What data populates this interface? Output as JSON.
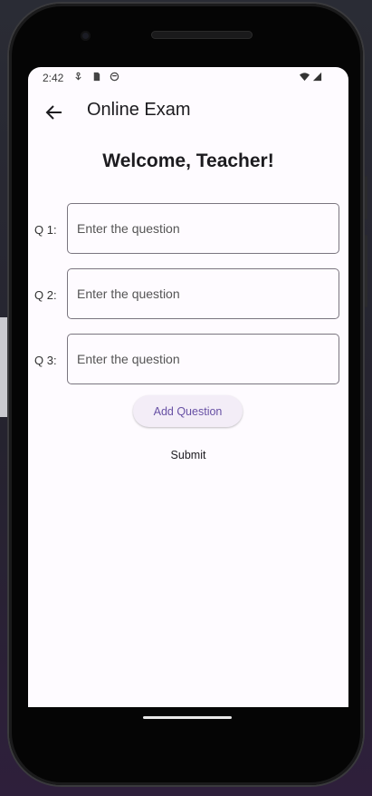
{
  "status_bar": {
    "time": "2:42"
  },
  "app_bar": {
    "title": "Online Exam"
  },
  "welcome_text": "Welcome, Teacher!",
  "questions": [
    {
      "label": "Q 1:",
      "placeholder": "Enter the question",
      "value": ""
    },
    {
      "label": "Q 2:",
      "placeholder": "Enter the question",
      "value": ""
    },
    {
      "label": "Q 3:",
      "placeholder": "Enter the question",
      "value": ""
    }
  ],
  "buttons": {
    "add_question": "Add Question",
    "submit": "Submit"
  },
  "colors": {
    "accent": "#6750a4",
    "surface": "#fefbff",
    "tonal_button": "#f3edf7",
    "outline": "#7a757f"
  }
}
